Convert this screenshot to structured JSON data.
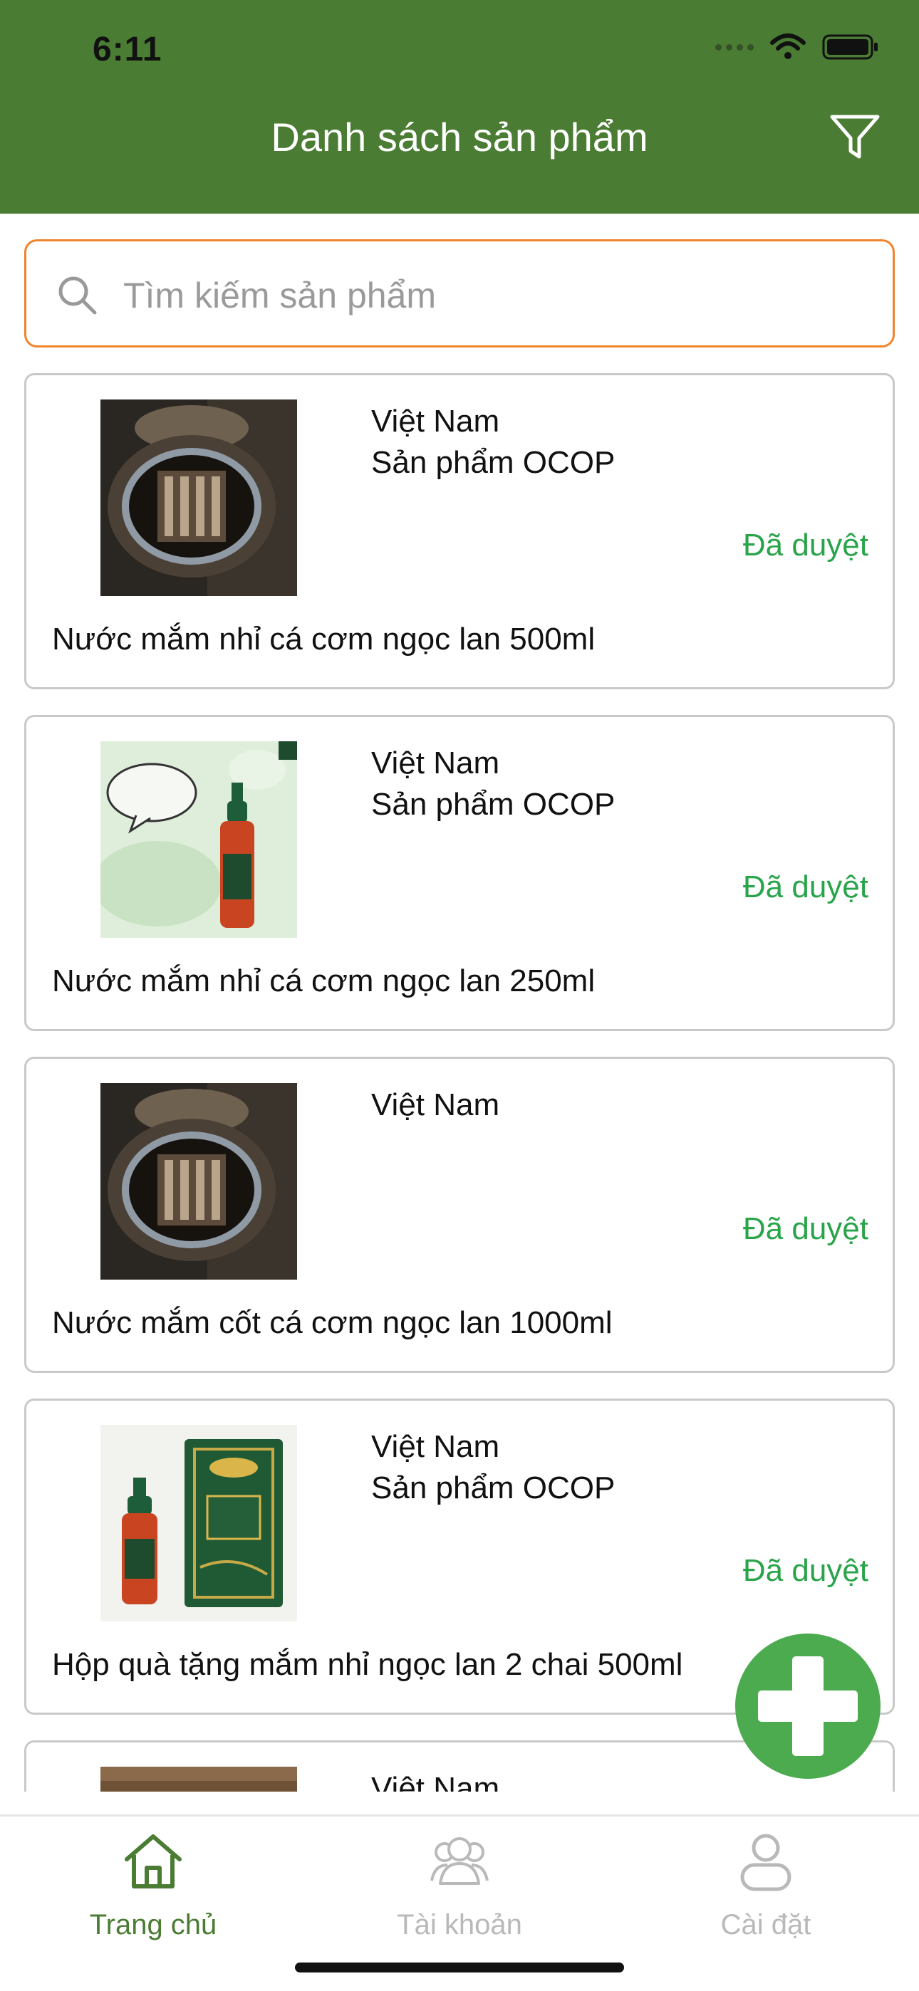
{
  "status_bar": {
    "time": "6:11"
  },
  "header": {
    "title": "Danh sách sản phẩm"
  },
  "search": {
    "placeholder": "Tìm kiếm sản phẩm"
  },
  "products": [
    {
      "origin": "Việt Nam",
      "ocop": "Sản phẩm OCOP",
      "status": "Đã duyệt",
      "name": "Nước mắm nhỉ cá cơm ngọc lan 500ml",
      "image": "clay-jar"
    },
    {
      "origin": "Việt Nam",
      "ocop": "Sản phẩm OCOP",
      "status": "Đã duyệt",
      "name": "Nước mắm nhỉ cá cơm ngọc lan 250ml",
      "image": "bottle-mam-nhi"
    },
    {
      "origin": "Việt Nam",
      "ocop": "",
      "status": "Đã duyệt",
      "name": "Nước mắm cốt cá cơm ngọc lan 1000ml",
      "image": "clay-jar"
    },
    {
      "origin": "Việt Nam",
      "ocop": "Sản phẩm OCOP",
      "status": "Đã duyệt",
      "name": "Hộp quà tặng mắm nhỉ ngọc lan 2 chai 500ml",
      "image": "gift-box"
    },
    {
      "origin": "Việt Nam",
      "ocop": "",
      "status": "",
      "name": "",
      "image": "wood"
    }
  ],
  "tabs": [
    {
      "label": "Trang chủ",
      "icon": "home-icon",
      "active": true
    },
    {
      "label": "Tài khoản",
      "icon": "users-icon",
      "active": false
    },
    {
      "label": "Cài đặt",
      "icon": "user-settings-icon",
      "active": false
    }
  ],
  "colors": {
    "header": "#4a7c33",
    "search_border": "#f0842c",
    "status_green": "#2aa44a",
    "fab": "#4caa4f",
    "active_tab": "#4a7c33",
    "inactive_tab": "#b9b9b9"
  }
}
